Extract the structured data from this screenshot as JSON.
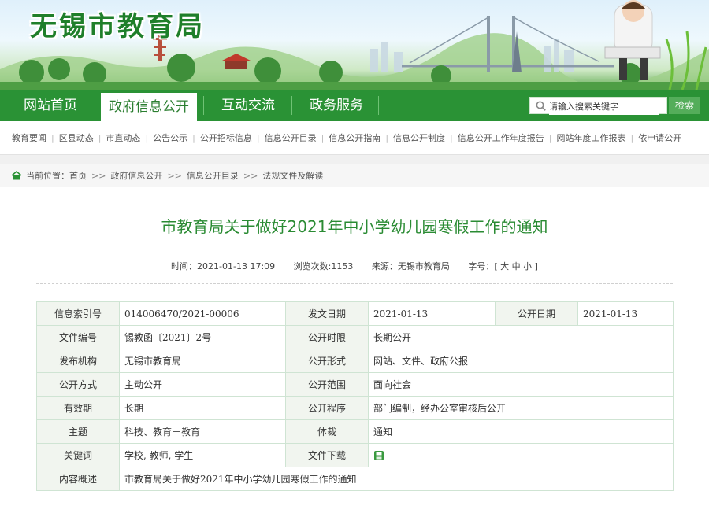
{
  "site": {
    "title": "无锡市教育局"
  },
  "nav": {
    "tabs": [
      {
        "label": "网站首页"
      },
      {
        "label": "政府信息公开"
      },
      {
        "label": "互动交流"
      },
      {
        "label": "政务服务"
      }
    ],
    "search": {
      "placeholder": "请输入搜索关键字",
      "button": "检索"
    }
  },
  "subnav": [
    "教育要闻",
    "区县动态",
    "市直动态",
    "公告公示",
    "公开招标信息",
    "信息公开目录",
    "信息公开指南",
    "信息公开制度",
    "信息公开工作年度报告",
    "网站年度工作报表",
    "依申请公开"
  ],
  "breadcrumb": {
    "prefix": "当前位置：",
    "items": [
      "首页",
      "政府信息公开",
      "信息公开目录",
      "法规文件及解读"
    ],
    "sep": ">>"
  },
  "article": {
    "title": "市教育局关于做好2021年中小学幼儿园寒假工作的通知",
    "meta": {
      "time": "时间：2021-01-13 17:09",
      "views": "浏览次数:1153",
      "source": "来源：无锡市教育局",
      "fontsize_label": "字号：[",
      "fs_large": "大",
      "fs_medium": "中",
      "fs_small": "小",
      "fontsize_end": "]"
    }
  },
  "info": {
    "index_label": "信息索引号",
    "index_value": "014006470/2021-00006",
    "issue_date_label": "发文日期",
    "issue_date_value": "2021-01-13",
    "open_date_label": "公开日期",
    "open_date_value": "2021-01-13",
    "doc_no_label": "文件编号",
    "doc_no_value": "锡教函〔2021〕2号",
    "open_period_label": "公开时限",
    "open_period_value": "长期公开",
    "publisher_label": "发布机构",
    "publisher_value": "无锡市教育局",
    "open_form_label": "公开形式",
    "open_form_value": "网站、文件、政府公报",
    "open_mode_label": "公开方式",
    "open_mode_value": "主动公开",
    "open_scope_label": "公开范围",
    "open_scope_value": "面向社会",
    "validity_label": "有效期",
    "validity_value": "长期",
    "procedure_label": "公开程序",
    "procedure_value": "部门编制，经办公室审核后公开",
    "topic_label": "主题",
    "topic_value": "科技、教育－教育",
    "genre_label": "体裁",
    "genre_value": "通知",
    "keywords_label": "关键词",
    "keywords_value": "学校, 教师, 学生",
    "download_label": "文件下载",
    "summary_label": "内容概述",
    "summary_value": "市教育局关于做好2021年中小学幼儿园寒假工作的通知"
  },
  "colors": {
    "green": "#2a9235",
    "title_green": "#2a8b33"
  }
}
